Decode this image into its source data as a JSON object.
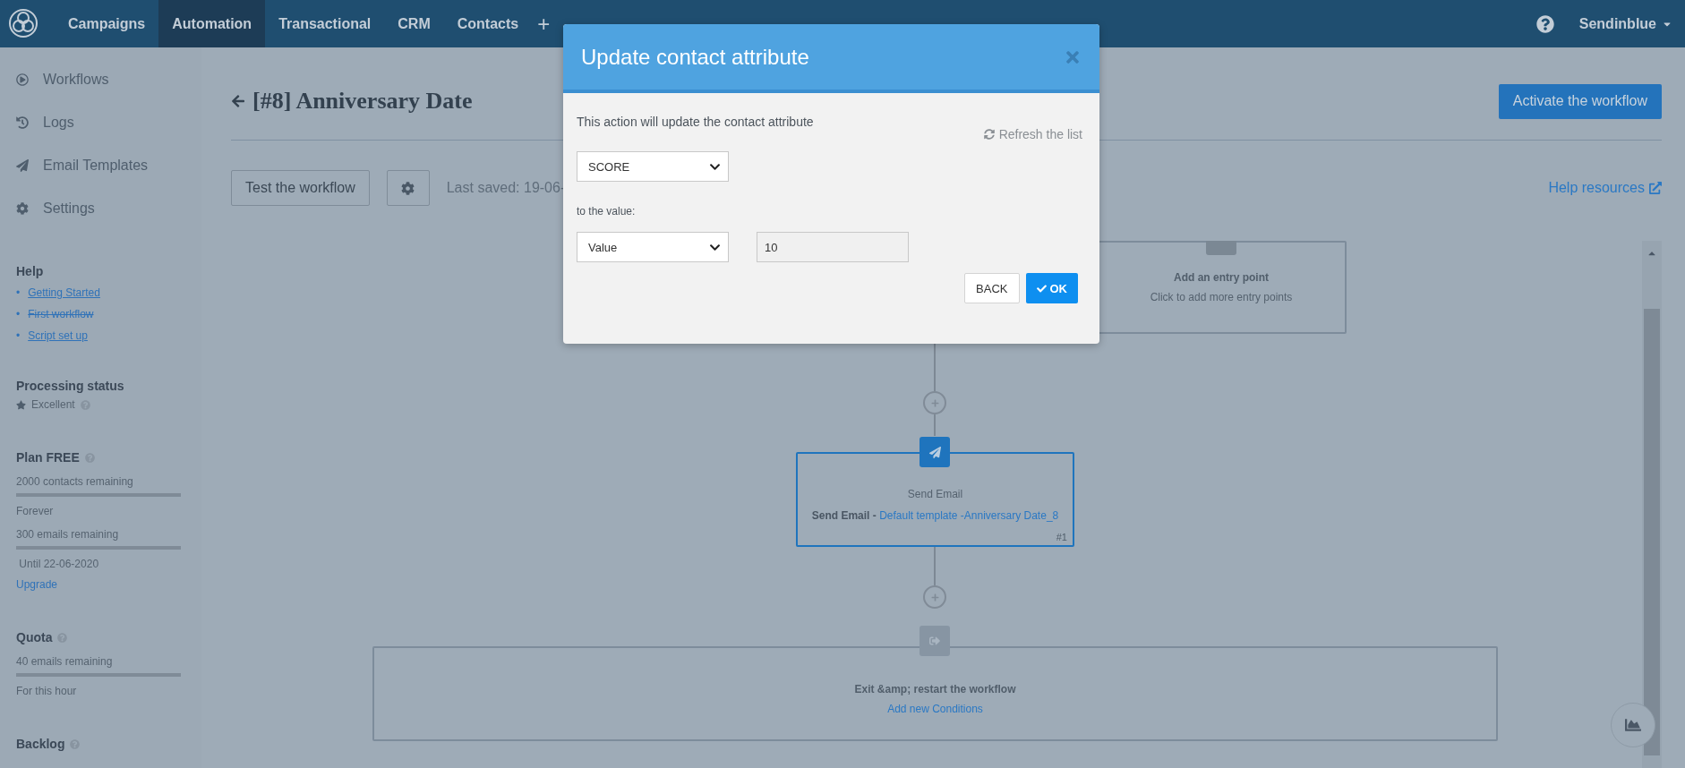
{
  "top_nav": {
    "tabs": [
      {
        "label": "Campaigns",
        "selected": false
      },
      {
        "label": "Automation",
        "selected": true
      },
      {
        "label": "Transactional",
        "selected": false
      },
      {
        "label": "CRM",
        "selected": false
      },
      {
        "label": "Contacts",
        "selected": false
      }
    ],
    "add": "+",
    "account": "Sendinblue"
  },
  "sidebar": {
    "nav": [
      {
        "label": "Workflows"
      },
      {
        "label": "Logs"
      },
      {
        "label": "Email Templates"
      },
      {
        "label": "Settings"
      }
    ],
    "help": {
      "title": "Help",
      "links": [
        {
          "marker": "•",
          "label": "Getting Started",
          "struck": false
        },
        {
          "marker": "•",
          "label": "First workflow",
          "struck": true
        },
        {
          "marker": "•",
          "label": "Script set up",
          "struck": false
        }
      ]
    },
    "processing": {
      "title": "Processing status",
      "status": "Excellent"
    },
    "plan": {
      "title": "Plan FREE",
      "meters": [
        {
          "label": "2000 contacts remaining",
          "level": 1,
          "note": "Forever"
        },
        {
          "label": "300 emails remaining",
          "level": 1,
          "note": " Until 22-06-2020"
        }
      ],
      "upgrade": "Upgrade"
    },
    "quota": {
      "title": "Quota",
      "label": "40 emails remaining",
      "level": 1,
      "note": "For this hour"
    },
    "backlog": {
      "title": "Backlog"
    }
  },
  "workflow": {
    "title": "[#8] Anniversary Date",
    "activate": "Activate the workflow",
    "test": "Test the workflow",
    "last_saved": "Last saved: 19-06-",
    "help_resources": "Help resources"
  },
  "canvas": {
    "entry": {
      "title": "Add an entry point",
      "subtitle": "Click to add more entry points"
    },
    "send_email": {
      "title": "Send Email",
      "action": "Send Email -",
      "template": "Default template -Anniversary Date_8",
      "number": "#1",
      "selected": true
    },
    "exit": {
      "title": "Exit &amp; restart the workflow",
      "link": "Add new Conditions"
    }
  },
  "modal": {
    "title": "Update contact attribute",
    "description": "This action will update the contact attribute",
    "refresh": "Refresh the list",
    "attribute": "SCORE",
    "to_label": "to the value:",
    "value_type": "Value",
    "value": "10",
    "back": "BACK",
    "ok": "OK"
  }
}
